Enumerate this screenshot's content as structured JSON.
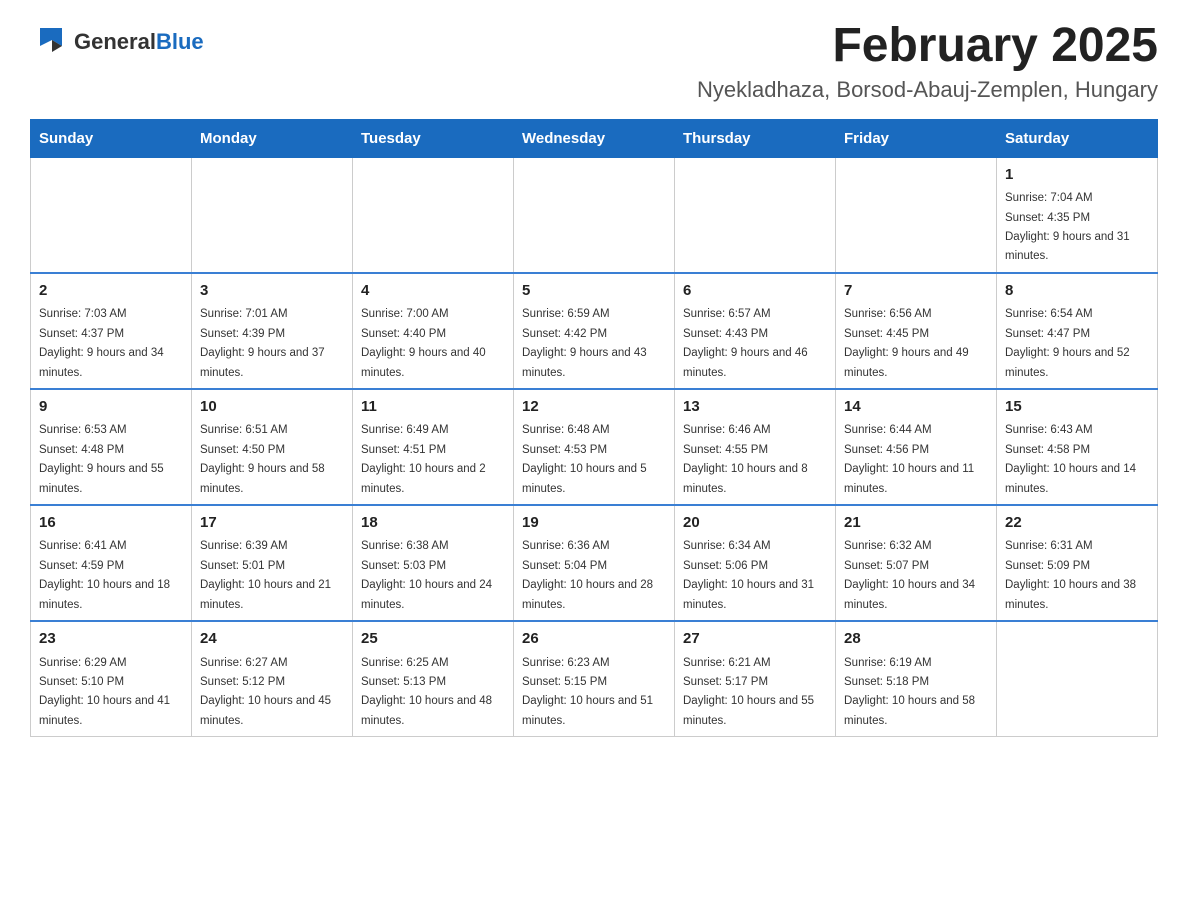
{
  "logo": {
    "general": "General",
    "blue": "Blue"
  },
  "header": {
    "month_title": "February 2025",
    "subtitle": "Nyekladhaza, Borsod-Abauj-Zemplen, Hungary"
  },
  "days_of_week": [
    "Sunday",
    "Monday",
    "Tuesday",
    "Wednesday",
    "Thursday",
    "Friday",
    "Saturday"
  ],
  "weeks": [
    [
      {
        "day": "",
        "info": ""
      },
      {
        "day": "",
        "info": ""
      },
      {
        "day": "",
        "info": ""
      },
      {
        "day": "",
        "info": ""
      },
      {
        "day": "",
        "info": ""
      },
      {
        "day": "",
        "info": ""
      },
      {
        "day": "1",
        "info": "Sunrise: 7:04 AM\nSunset: 4:35 PM\nDaylight: 9 hours and 31 minutes."
      }
    ],
    [
      {
        "day": "2",
        "info": "Sunrise: 7:03 AM\nSunset: 4:37 PM\nDaylight: 9 hours and 34 minutes."
      },
      {
        "day": "3",
        "info": "Sunrise: 7:01 AM\nSunset: 4:39 PM\nDaylight: 9 hours and 37 minutes."
      },
      {
        "day": "4",
        "info": "Sunrise: 7:00 AM\nSunset: 4:40 PM\nDaylight: 9 hours and 40 minutes."
      },
      {
        "day": "5",
        "info": "Sunrise: 6:59 AM\nSunset: 4:42 PM\nDaylight: 9 hours and 43 minutes."
      },
      {
        "day": "6",
        "info": "Sunrise: 6:57 AM\nSunset: 4:43 PM\nDaylight: 9 hours and 46 minutes."
      },
      {
        "day": "7",
        "info": "Sunrise: 6:56 AM\nSunset: 4:45 PM\nDaylight: 9 hours and 49 minutes."
      },
      {
        "day": "8",
        "info": "Sunrise: 6:54 AM\nSunset: 4:47 PM\nDaylight: 9 hours and 52 minutes."
      }
    ],
    [
      {
        "day": "9",
        "info": "Sunrise: 6:53 AM\nSunset: 4:48 PM\nDaylight: 9 hours and 55 minutes."
      },
      {
        "day": "10",
        "info": "Sunrise: 6:51 AM\nSunset: 4:50 PM\nDaylight: 9 hours and 58 minutes."
      },
      {
        "day": "11",
        "info": "Sunrise: 6:49 AM\nSunset: 4:51 PM\nDaylight: 10 hours and 2 minutes."
      },
      {
        "day": "12",
        "info": "Sunrise: 6:48 AM\nSunset: 4:53 PM\nDaylight: 10 hours and 5 minutes."
      },
      {
        "day": "13",
        "info": "Sunrise: 6:46 AM\nSunset: 4:55 PM\nDaylight: 10 hours and 8 minutes."
      },
      {
        "day": "14",
        "info": "Sunrise: 6:44 AM\nSunset: 4:56 PM\nDaylight: 10 hours and 11 minutes."
      },
      {
        "day": "15",
        "info": "Sunrise: 6:43 AM\nSunset: 4:58 PM\nDaylight: 10 hours and 14 minutes."
      }
    ],
    [
      {
        "day": "16",
        "info": "Sunrise: 6:41 AM\nSunset: 4:59 PM\nDaylight: 10 hours and 18 minutes."
      },
      {
        "day": "17",
        "info": "Sunrise: 6:39 AM\nSunset: 5:01 PM\nDaylight: 10 hours and 21 minutes."
      },
      {
        "day": "18",
        "info": "Sunrise: 6:38 AM\nSunset: 5:03 PM\nDaylight: 10 hours and 24 minutes."
      },
      {
        "day": "19",
        "info": "Sunrise: 6:36 AM\nSunset: 5:04 PM\nDaylight: 10 hours and 28 minutes."
      },
      {
        "day": "20",
        "info": "Sunrise: 6:34 AM\nSunset: 5:06 PM\nDaylight: 10 hours and 31 minutes."
      },
      {
        "day": "21",
        "info": "Sunrise: 6:32 AM\nSunset: 5:07 PM\nDaylight: 10 hours and 34 minutes."
      },
      {
        "day": "22",
        "info": "Sunrise: 6:31 AM\nSunset: 5:09 PM\nDaylight: 10 hours and 38 minutes."
      }
    ],
    [
      {
        "day": "23",
        "info": "Sunrise: 6:29 AM\nSunset: 5:10 PM\nDaylight: 10 hours and 41 minutes."
      },
      {
        "day": "24",
        "info": "Sunrise: 6:27 AM\nSunset: 5:12 PM\nDaylight: 10 hours and 45 minutes."
      },
      {
        "day": "25",
        "info": "Sunrise: 6:25 AM\nSunset: 5:13 PM\nDaylight: 10 hours and 48 minutes."
      },
      {
        "day": "26",
        "info": "Sunrise: 6:23 AM\nSunset: 5:15 PM\nDaylight: 10 hours and 51 minutes."
      },
      {
        "day": "27",
        "info": "Sunrise: 6:21 AM\nSunset: 5:17 PM\nDaylight: 10 hours and 55 minutes."
      },
      {
        "day": "28",
        "info": "Sunrise: 6:19 AM\nSunset: 5:18 PM\nDaylight: 10 hours and 58 minutes."
      },
      {
        "day": "",
        "info": ""
      }
    ]
  ]
}
